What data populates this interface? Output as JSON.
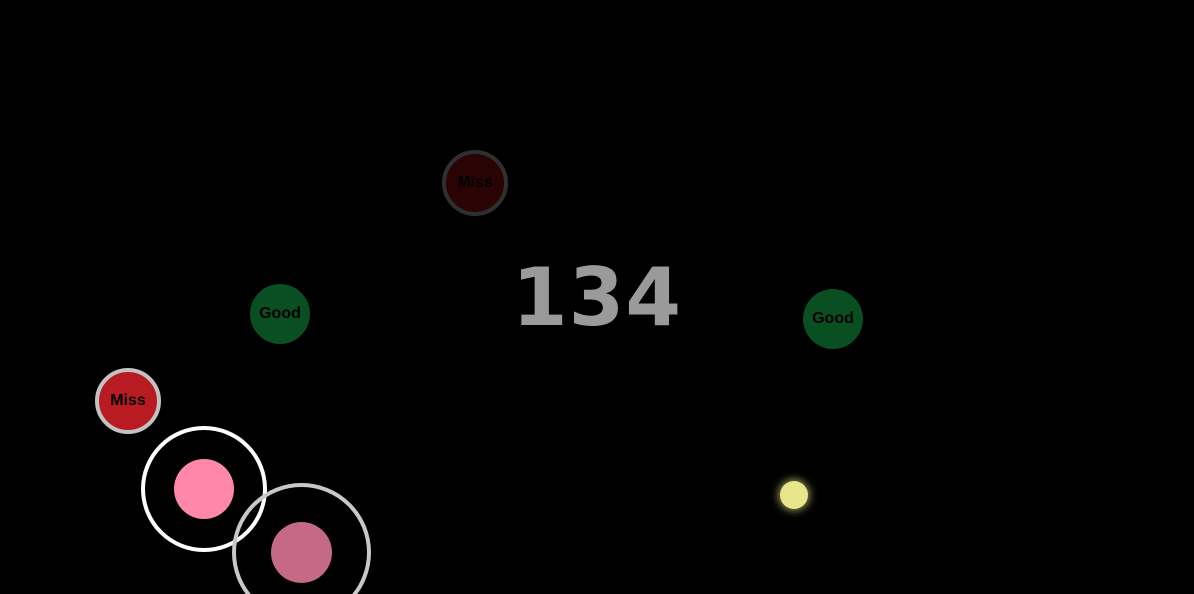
{
  "score": "134",
  "judgements": {
    "good_left": "Good",
    "good_right": "Good",
    "miss_top_faded": "Miss",
    "miss_left": "Miss"
  },
  "colors": {
    "background": "#000000",
    "score": "#9a9a9a",
    "good": "#0a4f22",
    "miss": "#b81c22",
    "miss_faded": "#2a0405",
    "hit_circle_active": "#ff88aa",
    "hit_circle_next": "#c46a84",
    "cursor": "#e8e68a"
  },
  "icons": {
    "cursor": "cursor-dot-icon"
  }
}
